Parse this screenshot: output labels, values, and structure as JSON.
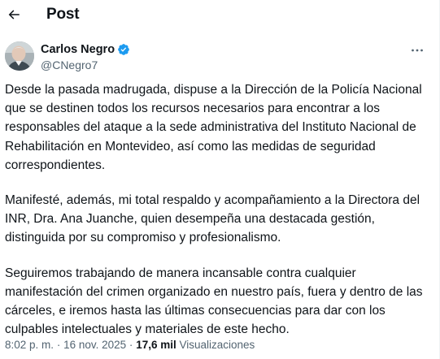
{
  "header": {
    "title": "Post"
  },
  "author": {
    "name": "Carlos Negro",
    "handle": "@CNegro7"
  },
  "tweet": {
    "paragraphs": [
      "Desde la pasada madrugada, dispuse a la Dirección de la Policía Nacional que se destinen todos los recursos necesarios para encontrar a los responsables del ataque a la sede administrativa del Instituto Nacional de Rehabilitación en Montevideo, así como las medidas de seguridad correspondientes.",
      "Manifesté, además, mi total respaldo y acompañamiento a la Directora del INR, Dra. Ana Juanche, quien desempeña una destacada gestión, distinguida por su compromiso y profesionalismo.",
      "Seguiremos trabajando de manera incansable contra cualquier manifestación del crimen organizado en nuestro país, fuera y dentro de las cárceles, e iremos hasta las últimas consecuencias para dar con los culpables intelectuales y materiales de este hecho."
    ]
  },
  "meta": {
    "time": "8:02 p. m.",
    "separator": "·",
    "date": "16 nov. 2025",
    "views_count": "17,6 mil",
    "views_label": "Visualizaciones"
  },
  "colors": {
    "text": "#0f1419",
    "secondary": "#536471",
    "verified": "#1d9bf0"
  },
  "icons": {
    "back": "arrow-left-icon",
    "verified": "verified-badge-icon",
    "more": "more-options-icon"
  }
}
